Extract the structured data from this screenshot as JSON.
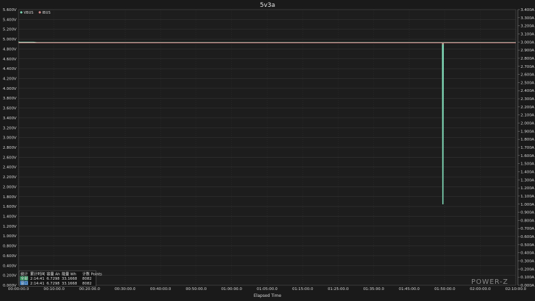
{
  "chart_data": {
    "type": "line",
    "title": "5v3a",
    "xlabel": "Elapsed Time",
    "x_ticks": [
      "00:00:00.0",
      "00:10:00.0",
      "00:20:00.0",
      "00:30:00.0",
      "00:40:00.0",
      "00:50:00.0",
      "01:00:00.0",
      "01:05:00.0",
      "01:15:00.0",
      "01:25:00.0",
      "01:35:00.0",
      "01:45:00.0",
      "01:50:00.0",
      "02:00:00.0",
      "02:10:00.0"
    ],
    "y_left_ticks": [
      "0.000V",
      "0.200V",
      "0.400V",
      "0.600V",
      "0.800V",
      "1.000V",
      "1.200V",
      "1.400V",
      "1.600V",
      "1.800V",
      "2.000V",
      "2.200V",
      "2.400V",
      "2.600V",
      "2.800V",
      "3.000V",
      "3.200V",
      "3.400V",
      "3.600V",
      "3.800V",
      "4.000V",
      "4.200V",
      "4.400V",
      "4.600V",
      "4.800V",
      "5.000V",
      "5.200V",
      "5.400V",
      "5.600V"
    ],
    "y_right_ticks": [
      "0.000A",
      "0.100A",
      "0.200A",
      "0.300A",
      "0.400A",
      "0.500A",
      "0.600A",
      "0.700A",
      "0.800A",
      "0.900A",
      "1.000A",
      "1.100A",
      "1.200A",
      "1.300A",
      "1.400A",
      "1.500A",
      "1.600A",
      "1.700A",
      "1.800A",
      "1.900A",
      "2.000A",
      "2.100A",
      "2.200A",
      "2.300A",
      "2.400A",
      "2.500A",
      "2.600A",
      "2.700A",
      "2.800A",
      "2.900A",
      "3.000A",
      "3.100A",
      "3.200A",
      "3.300A",
      "3.400A"
    ],
    "ylim_left": [
      0,
      5.6
    ],
    "ylim_right": [
      0,
      3.4
    ],
    "xlim_minutes": [
      0,
      134.7
    ],
    "grid": true,
    "legend_position": "top-left",
    "series": [
      {
        "name": "VBUS",
        "axis": "left",
        "color": "#7fd8b6",
        "x": [
          0,
          0.2,
          4,
          5,
          30,
          60,
          90,
          114.8,
          114.9,
          114.95,
          115.0,
          115.1,
          130,
          134.7
        ],
        "y": [
          4.95,
          4.94,
          4.94,
          4.93,
          4.93,
          4.93,
          4.93,
          4.93,
          1.65,
          4.93,
          1.65,
          4.93,
          4.93,
          4.93
        ]
      },
      {
        "name": "IBUS",
        "axis": "right",
        "color": "#d88a8a",
        "x": [
          0,
          4,
          5,
          30,
          60,
          90,
          114.8,
          114.9,
          115.1,
          130,
          134.7
        ],
        "y": [
          2.99,
          2.99,
          2.99,
          2.99,
          2.99,
          2.99,
          2.99,
          2.97,
          2.99,
          2.99,
          2.99
        ]
      }
    ]
  },
  "stats": {
    "header": [
      "统计",
      "累计时间",
      "容量 Ah",
      "能量 Wh",
      "计数 Points"
    ],
    "rows": [
      {
        "label": "全部",
        "color": "#2e8b57",
        "values": [
          "2:14:41",
          "6.7298",
          "33.1668",
          "8082"
        ]
      },
      {
        "label": "窗口",
        "color": "#2a6db0",
        "values": [
          "2:14:41",
          "6.7298",
          "33.1668",
          "8082"
        ]
      }
    ]
  },
  "watermark": "POWER-Z"
}
